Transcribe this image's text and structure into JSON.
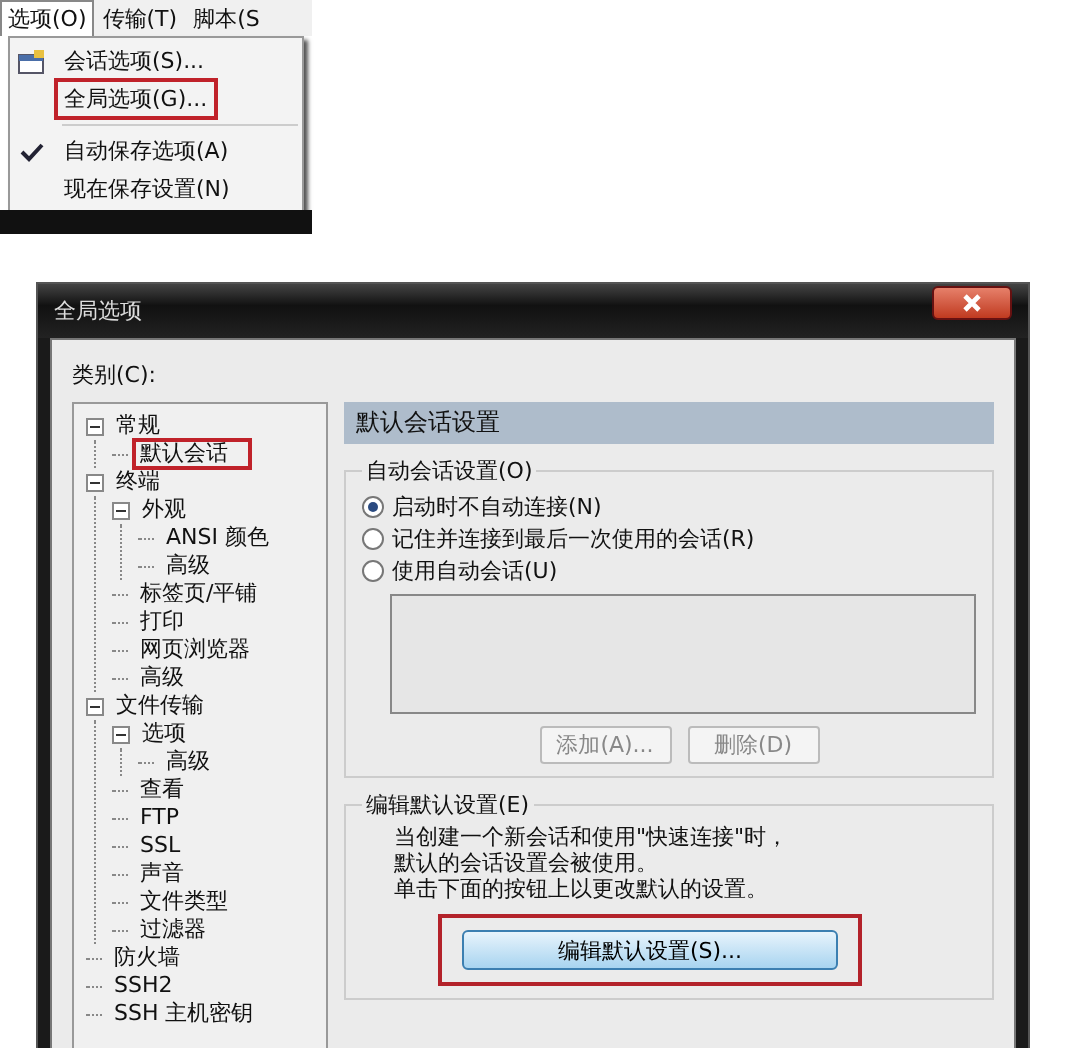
{
  "menu_screenshot": {
    "menubar": [
      {
        "label": "选项(O)",
        "selected": true
      },
      {
        "label": "传输(T)",
        "selected": false
      },
      {
        "label": "脚本(S",
        "selected": false
      }
    ],
    "items": [
      {
        "kind": "icon",
        "label": "会话选项(S)...",
        "checked": false,
        "highlighted": false
      },
      {
        "kind": "plain",
        "label": "全局选项(G)...",
        "checked": false,
        "highlighted": true
      },
      {
        "kind": "separator"
      },
      {
        "kind": "plain",
        "label": "自动保存选项(A)",
        "checked": true,
        "highlighted": false
      },
      {
        "kind": "plain",
        "label": "现在保存设置(N)",
        "checked": false,
        "highlighted": false
      }
    ]
  },
  "window": {
    "title": "全局选项",
    "category_label": "类别(C):",
    "tree": [
      {
        "label": "常规",
        "expanded": true,
        "highlighted": false,
        "children": [
          {
            "label": "默认会话",
            "highlighted": true
          }
        ]
      },
      {
        "label": "终端",
        "expanded": true,
        "highlighted": false,
        "children": [
          {
            "label": "外观",
            "expanded": true,
            "highlighted": false,
            "children": [
              {
                "label": "ANSI 颜色",
                "highlighted": false
              },
              {
                "label": "高级",
                "highlighted": false
              }
            ]
          },
          {
            "label": "标签页/平铺",
            "highlighted": false
          },
          {
            "label": "打印",
            "highlighted": false
          },
          {
            "label": "网页浏览器",
            "highlighted": false
          },
          {
            "label": "高级",
            "highlighted": false
          }
        ]
      },
      {
        "label": "文件传输",
        "expanded": true,
        "highlighted": false,
        "children": [
          {
            "label": "选项",
            "expanded": true,
            "highlighted": false,
            "children": [
              {
                "label": "高级",
                "highlighted": false
              }
            ]
          },
          {
            "label": "查看",
            "highlighted": false
          },
          {
            "label": "FTP",
            "highlighted": false
          },
          {
            "label": "SSL",
            "highlighted": false
          },
          {
            "label": "声音",
            "highlighted": false
          },
          {
            "label": "文件类型",
            "highlighted": false
          },
          {
            "label": "过滤器",
            "highlighted": false
          }
        ]
      },
      {
        "label": "防火墙",
        "highlighted": false
      },
      {
        "label": "SSH2",
        "highlighted": false
      },
      {
        "label": "SSH 主机密钥",
        "highlighted": false
      }
    ],
    "panel": {
      "header": "默认会话设置",
      "auto_group": {
        "title": "自动会话设置(O)",
        "radios": [
          {
            "label": "启动时不自动连接(N)",
            "selected": true
          },
          {
            "label": "记住并连接到最后一次使用的会话(R)",
            "selected": false
          },
          {
            "label": "使用自动会话(U)",
            "selected": false
          }
        ],
        "buttons": [
          {
            "label": "添加(A)...",
            "disabled": true
          },
          {
            "label": "删除(D)",
            "disabled": true
          }
        ]
      },
      "edit_group": {
        "title": "编辑默认设置(E)",
        "lines": [
          "当创建一个新会话和使用\"快速连接\"时，",
          "默认的会话设置会被使用。",
          "单击下面的按钮上以更改默认的设置。"
        ],
        "button": {
          "label": "编辑默认设置(S)...",
          "highlighted": true
        }
      }
    }
  }
}
